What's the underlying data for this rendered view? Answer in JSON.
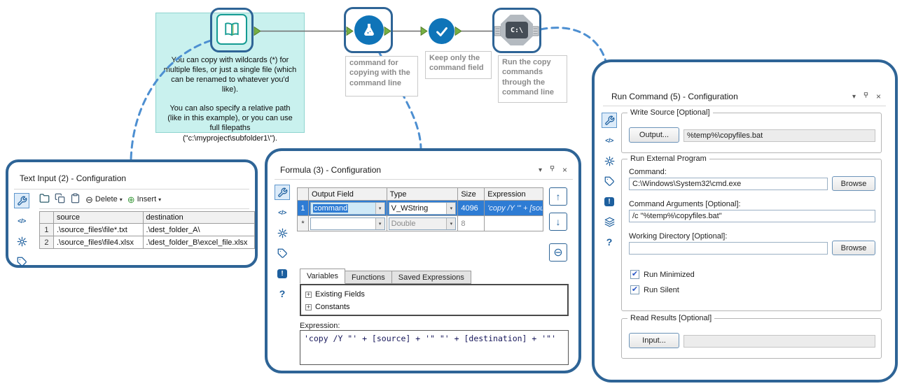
{
  "colors": {
    "panel_border": "#2e6496",
    "dashed_connector": "#4d8fd1",
    "comment_bg": "#c9f1ee",
    "tool_teal": "#149b92",
    "tool_blue": "#0f74b8",
    "anchor_green": "#76b043",
    "row_selection": "#2e7cd4"
  },
  "icons": {
    "dropdown_arrow": "▾",
    "window_close": "×",
    "delete_circle": "⊖",
    "insert_circle": "⊕",
    "up_arrow": "↑",
    "down_arrow": "↓",
    "remove_row": "⊖",
    "check": "✔",
    "tree_expand": "+",
    "code": "</>",
    "question": "?",
    "exclamation": "!"
  },
  "workflow": {
    "comment": {
      "paragraph1": "You can copy with wildcards (*) for multiple files, or just a single file (which can be renamed to whatever you'd like).",
      "paragraph2": "You can also specify a relative path (like in this example), or you can use full filepaths (\"c:\\myproject\\subfolder1\\\")."
    },
    "tools": {
      "formula": {
        "annotation": "command for copying with the command line"
      },
      "select": {
        "annotation": "Keep only the command field"
      },
      "run_command": {
        "annotation": "Run the copy commands through the command line",
        "icon_label": "C:\\"
      }
    }
  },
  "text_input_panel": {
    "title": "Text Input (2) - Configuration",
    "toolbar": {
      "delete_label": "Delete",
      "insert_label": "Insert"
    },
    "grid": {
      "headers": {
        "source": "source",
        "destination": "destination"
      },
      "rows": [
        {
          "num": "1",
          "source": ".\\source_files\\file*.txt",
          "destination": ".\\dest_folder_A\\"
        },
        {
          "num": "2",
          "source": ".\\source_files\\file4.xlsx",
          "destination": ".\\dest_folder_B\\excel_file.xlsx"
        }
      ]
    }
  },
  "formula_panel": {
    "title": "Formula (3) - Configuration",
    "grid": {
      "headers": {
        "output_field": "Output Field",
        "type": "Type",
        "size": "Size",
        "expression": "Expression"
      },
      "row1": {
        "num": "1",
        "field": "command",
        "type": "V_WString",
        "size": "4096",
        "expression_preview": "'copy /Y \"' + [sou..."
      },
      "row2": {
        "num": "*",
        "type": "Double",
        "size": "8"
      }
    },
    "tabs": {
      "variables": "Variables",
      "functions": "Functions",
      "saved": "Saved Expressions"
    },
    "tree": {
      "item1": "Existing Fields",
      "item2": "Constants"
    },
    "expression_label": "Expression:",
    "expression_value": "'copy /Y \"' + [source] + '\" \"' + [destination] + '\"'"
  },
  "run_command_panel": {
    "title": "Run Command (5) - Configuration",
    "write_source": {
      "legend": "Write Source [Optional]",
      "output_button": "Output...",
      "value": "%temp%\\copyfiles.bat"
    },
    "run_external": {
      "legend": "Run External Program",
      "command_label": "Command:",
      "command_value": "C:\\Windows\\System32\\cmd.exe",
      "browse_button": "Browse",
      "arguments_label": "Command Arguments [Optional]:",
      "arguments_value": "/c \"%temp%\\copyfiles.bat\"",
      "working_dir_label": "Working Directory [Optional]:",
      "working_dir_value": "",
      "run_minimized_label": "Run Minimized",
      "run_silent_label": "Run Silent",
      "run_minimized_checked": true,
      "run_silent_checked": true
    },
    "read_results": {
      "legend": "Read Results [Optional]",
      "input_button": "Input...",
      "value": ""
    }
  }
}
